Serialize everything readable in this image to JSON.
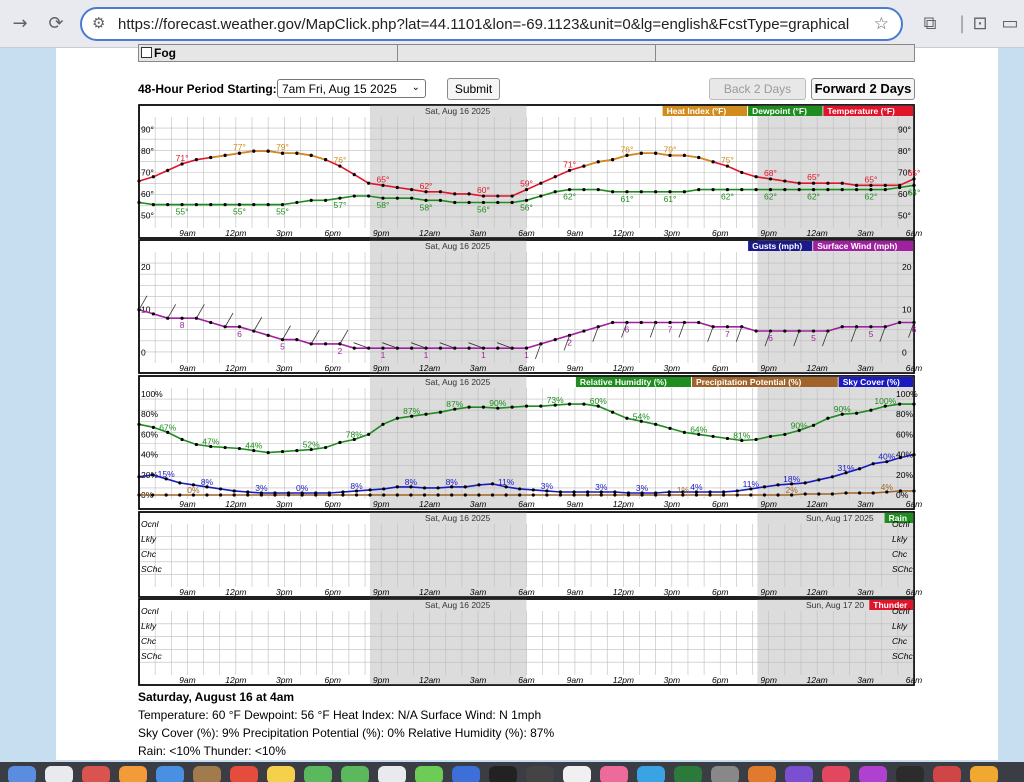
{
  "browser": {
    "url": "https://forecast.weather.gov/MapClick.php?lat=44.1101&lon=-69.1123&unit=0&lg=english&FcstType=graphical",
    "back_icon": "arrow-right-icon",
    "reload_icon": "reload-icon"
  },
  "fog": {
    "label": "Fog"
  },
  "controls": {
    "period_label": "48-Hour Period Starting:",
    "period_value": "7am Fri, Aug 15 2025",
    "submit_label": "Submit",
    "back_label": "Back 2 Days",
    "forward_label": "Forward 2 Days"
  },
  "observation": {
    "title": "Saturday, August 16 at 4am",
    "line1": "Temperature: 60 °F    Dewpoint: 56 °F    Heat Index: N/A    Surface Wind: N 1mph",
    "line2": "Sky Cover (%): 9%    Precipitation Potential (%): 0%    Relative Humidity (%): 87%",
    "line3": "Rain: <10%    Thunder: <10%"
  },
  "chart_data": [
    {
      "type": "line",
      "date_label": "Sat, Aug 16 2025",
      "time_labels": [
        "9am",
        "12pm",
        "3pm",
        "6pm",
        "9pm",
        "12am",
        "3am",
        "6am",
        "9am",
        "12pm",
        "3pm",
        "6pm",
        "9pm",
        "12am",
        "3am",
        "6am"
      ],
      "y_ticks": [
        "90°",
        "80°",
        "70°",
        "60°",
        "50°"
      ],
      "ylim": [
        45,
        95
      ],
      "legend": [
        {
          "name": "Heat Index (°F)",
          "color": "#d28b1d"
        },
        {
          "name": "Dewpoint (°F)",
          "color": "#1e8c1e"
        },
        {
          "name": "Temperature (°F)",
          "color": "#e0142a"
        }
      ],
      "series": [
        {
          "name": "Temperature (°F)",
          "color": "#e0142a",
          "values": [
            66,
            68,
            71,
            74,
            76,
            77,
            78,
            79,
            80,
            80,
            79,
            79,
            78,
            76,
            73,
            69,
            65,
            64,
            63,
            62,
            61,
            61,
            60,
            60,
            59,
            59,
            59,
            62,
            65,
            68,
            71,
            73,
            75,
            76,
            78,
            79,
            79,
            78,
            78,
            77,
            75,
            73,
            70,
            68,
            67,
            66,
            65,
            65,
            65,
            65,
            64,
            64,
            64,
            64,
            67
          ]
        },
        {
          "name": "Dewpoint (°F)",
          "color": "#1e8c1e",
          "values": [
            56,
            55,
            55,
            55,
            55,
            55,
            55,
            55,
            55,
            55,
            55,
            56,
            57,
            57,
            58,
            59,
            59,
            58,
            58,
            58,
            57,
            57,
            56,
            56,
            56,
            56,
            56,
            57,
            59,
            61,
            62,
            62,
            62,
            61,
            61,
            61,
            61,
            61,
            61,
            62,
            62,
            62,
            62,
            62,
            62,
            62,
            62,
            62,
            62,
            62,
            62,
            62,
            62,
            63,
            64
          ]
        },
        {
          "name": "Heat Index (°F)",
          "color": "#d28b1d",
          "values": [
            null,
            null,
            null,
            null,
            null,
            77,
            78,
            79,
            80,
            80,
            79,
            79,
            78,
            76,
            null,
            null,
            null,
            null,
            null,
            null,
            null,
            null,
            null,
            null,
            null,
            null,
            null,
            null,
            null,
            null,
            null,
            73,
            75,
            76,
            78,
            79,
            79,
            78,
            78,
            77,
            75,
            null,
            null,
            null,
            null,
            null,
            null,
            null,
            null,
            null,
            null,
            null,
            null,
            null,
            null
          ]
        }
      ],
      "data_labels": [
        {
          "i": 1,
          "series": "Temperature (°F)",
          "text": "71°"
        },
        {
          "i": 3,
          "series": "Heat Index (°F)",
          "text": "77°"
        },
        {
          "i": 5,
          "series": "Heat Index (°F)",
          "text": "79°"
        },
        {
          "i": 7,
          "series": "Heat Index (°F)",
          "text": "76°"
        },
        {
          "i": 9,
          "series": "Temperature (°F)",
          "text": "65°"
        },
        {
          "i": 11,
          "series": "Temperature (°F)",
          "text": "62°"
        },
        {
          "i": 13,
          "series": "Temperature (°F)",
          "text": "60°"
        },
        {
          "i": 15,
          "series": "Temperature (°F)",
          "text": "59°"
        },
        {
          "i": 17,
          "series": "Temperature (°F)",
          "text": "71°"
        },
        {
          "i": 19,
          "series": "Heat Index (°F)",
          "text": "76°"
        },
        {
          "i": 21,
          "series": "Heat Index (°F)",
          "text": "79°"
        },
        {
          "i": 23,
          "series": "Heat Index (°F)",
          "text": "75°"
        },
        {
          "i": 25,
          "series": "Temperature (°F)",
          "text": "68°"
        },
        {
          "i": 27,
          "series": "Temperature (°F)",
          "text": "65°"
        },
        {
          "i": 29,
          "series": "Temperature (°F)",
          "text": "65°"
        },
        {
          "i": 31,
          "series": "Temperature (°F)",
          "text": "65°"
        },
        {
          "i": 1,
          "series": "Dewpoint (°F)",
          "text": "55°"
        },
        {
          "i": 3,
          "series": "Dewpoint (°F)",
          "text": "55°"
        },
        {
          "i": 5,
          "series": "Dewpoint (°F)",
          "text": "55°"
        },
        {
          "i": 7,
          "series": "Dewpoint (°F)",
          "text": "57°"
        },
        {
          "i": 9,
          "series": "Dewpoint (°F)",
          "text": "58°"
        },
        {
          "i": 11,
          "series": "Dewpoint (°F)",
          "text": "58°"
        },
        {
          "i": 13,
          "series": "Dewpoint (°F)",
          "text": "56°"
        },
        {
          "i": 15,
          "series": "Dewpoint (°F)",
          "text": "56°"
        },
        {
          "i": 17,
          "series": "Dewpoint (°F)",
          "text": "62°"
        },
        {
          "i": 19,
          "series": "Dewpoint (°F)",
          "text": "61°"
        },
        {
          "i": 21,
          "series": "Dewpoint (°F)",
          "text": "61°"
        },
        {
          "i": 23,
          "series": "Dewpoint (°F)",
          "text": "62°"
        },
        {
          "i": 25,
          "series": "Dewpoint (°F)",
          "text": "62°"
        },
        {
          "i": 27,
          "series": "Dewpoint (°F)",
          "text": "62°"
        },
        {
          "i": 29,
          "series": "Dewpoint (°F)",
          "text": "62°"
        },
        {
          "i": 31,
          "series": "Dewpoint (°F)",
          "text": "64°"
        }
      ]
    },
    {
      "type": "line",
      "date_label": "Sat, Aug 16 2025",
      "y_ticks": [
        "20",
        "10",
        "0"
      ],
      "ylim": [
        -2,
        23
      ],
      "legend": [
        {
          "name": "Gusts (mph)",
          "color": "#1a1a8c"
        },
        {
          "name": "Surface Wind (mph)",
          "color": "#a020a0"
        }
      ],
      "series": [
        {
          "name": "Surface Wind (mph)",
          "color": "#a020a0",
          "values": [
            10,
            9,
            8,
            8,
            8,
            7,
            6,
            6,
            5,
            4,
            3,
            3,
            2,
            2,
            2,
            1,
            1,
            1,
            1,
            1,
            1,
            1,
            1,
            1,
            1,
            1,
            1,
            1,
            2,
            3,
            4,
            5,
            6,
            7,
            7,
            7,
            7,
            7,
            7,
            7,
            6,
            6,
            6,
            5,
            5,
            5,
            5,
            5,
            5,
            6,
            6,
            6,
            6,
            7,
            7
          ]
        }
      ],
      "data_labels": [
        {
          "i": 2,
          "text": "8"
        },
        {
          "i": 4,
          "text": "6"
        },
        {
          "i": 6,
          "text": "5"
        },
        {
          "i": 8,
          "text": "2"
        },
        {
          "i": 10,
          "text": "1"
        },
        {
          "i": 12,
          "text": "1"
        },
        {
          "i": 14,
          "text": "1"
        },
        {
          "i": 16,
          "text": "1"
        },
        {
          "i": 18,
          "text": "2"
        },
        {
          "i": 20,
          "text": "6"
        },
        {
          "i": 22,
          "text": "7"
        },
        {
          "i": 24,
          "text": "7"
        },
        {
          "i": 26,
          "text": "6"
        },
        {
          "i": 28,
          "text": "5"
        },
        {
          "i": 30,
          "text": "5"
        },
        {
          "i": 32,
          "text": "6"
        }
      ]
    },
    {
      "type": "line",
      "date_label": "Sat, Aug 16 2025",
      "y_ticks": [
        "100%",
        "80%",
        "60%",
        "40%",
        "20%",
        "0%"
      ],
      "ylim": [
        0,
        100
      ],
      "legend": [
        {
          "name": "Relative Humidity (%)",
          "color": "#1e8c1e"
        },
        {
          "name": "Precipitation Potential (%)",
          "color": "#a0642a"
        },
        {
          "name": "Sky Cover (%)",
          "color": "#1a1ac0"
        }
      ],
      "series": [
        {
          "name": "Relative Humidity (%)",
          "color": "#1e8c1e",
          "values": [
            70,
            67,
            62,
            55,
            50,
            48,
            47,
            46,
            44,
            42,
            43,
            44,
            45,
            47,
            52,
            55,
            60,
            70,
            76,
            78,
            80,
            82,
            85,
            87,
            87,
            86,
            87,
            88,
            88,
            89,
            90,
            90,
            88,
            82,
            76,
            73,
            70,
            66,
            62,
            60,
            58,
            56,
            54,
            55,
            58,
            60,
            64,
            69,
            76,
            80,
            81,
            84,
            88,
            90,
            90
          ]
        },
        {
          "name": "Sky Cover (%)",
          "color": "#1a1ac0",
          "values": [
            18,
            20,
            16,
            12,
            10,
            8,
            6,
            4,
            3,
            2,
            2,
            2,
            2,
            2,
            2,
            3,
            4,
            5,
            6,
            8,
            8,
            7,
            7,
            8,
            8,
            10,
            11,
            8,
            6,
            5,
            4,
            3,
            3,
            3,
            3,
            3,
            2,
            2,
            2,
            3,
            3,
            3,
            3,
            3,
            4,
            6,
            8,
            10,
            11,
            12,
            15,
            18,
            22,
            26,
            31,
            33,
            37,
            40
          ]
        },
        {
          "name": "Precipitation Potential (%)",
          "color": "#a0642a",
          "values": [
            0,
            0,
            0,
            0,
            0,
            0,
            0,
            0,
            0,
            0,
            0,
            0,
            0,
            0,
            0,
            0,
            0,
            0,
            0,
            0,
            0,
            0,
            0,
            0,
            0,
            0,
            0,
            0,
            0,
            0,
            0,
            0,
            0,
            0,
            0,
            0,
            0,
            0,
            0,
            0,
            0,
            0,
            0,
            0,
            0,
            0,
            0,
            0,
            0,
            1,
            1,
            1,
            2,
            2,
            2,
            3,
            4,
            4
          ]
        }
      ],
      "data_labels": [
        {
          "text": "67%",
          "series": "Relative Humidity (%)"
        },
        {
          "text": "47%"
        },
        {
          "text": "44%"
        },
        {
          "text": "52%"
        },
        {
          "text": "78%"
        },
        {
          "text": "87%"
        },
        {
          "text": "87%"
        },
        {
          "text": "90%"
        },
        {
          "text": "73%"
        },
        {
          "text": "60%"
        },
        {
          "text": "54%"
        },
        {
          "text": "64%"
        },
        {
          "text": "81%"
        },
        {
          "text": "90%"
        },
        {
          "text": "90%"
        },
        {
          "text": "100%"
        },
        {
          "text": "15%",
          "series": "Sky Cover (%)"
        },
        {
          "text": "8%"
        },
        {
          "text": "3%"
        },
        {
          "text": "0%"
        },
        {
          "text": "8%"
        },
        {
          "text": "8%"
        },
        {
          "text": "8%"
        },
        {
          "text": "11%"
        },
        {
          "text": "3%"
        },
        {
          "text": "3%"
        },
        {
          "text": "3%"
        },
        {
          "text": "4%"
        },
        {
          "text": "11%"
        },
        {
          "text": "18%"
        },
        {
          "text": "31%"
        },
        {
          "text": "40%"
        },
        {
          "text": "0%",
          "series": "Precipitation Potential (%)"
        },
        {
          "text": "1%"
        },
        {
          "text": "2%"
        },
        {
          "text": "4%"
        }
      ]
    },
    {
      "type": "line",
      "date_label_left": "Sat, Aug 16 2025",
      "date_label_right": "Sun, Aug 17 2025",
      "y_ticks": [
        "Ocnl",
        "Lkly",
        "Chc",
        "SChc"
      ],
      "legend": [
        {
          "name": "Rain",
          "color": "#1e8c1e"
        }
      ],
      "series": []
    },
    {
      "type": "line",
      "date_label_left": "Sat, Aug 16 2025",
      "date_label_right": "Sun, Aug 17 20",
      "y_ticks": [
        "Ocnl",
        "Lkly",
        "Chc",
        "SChc"
      ],
      "legend": [
        {
          "name": "Thunder",
          "color": "#e0142a"
        }
      ],
      "series": []
    }
  ]
}
